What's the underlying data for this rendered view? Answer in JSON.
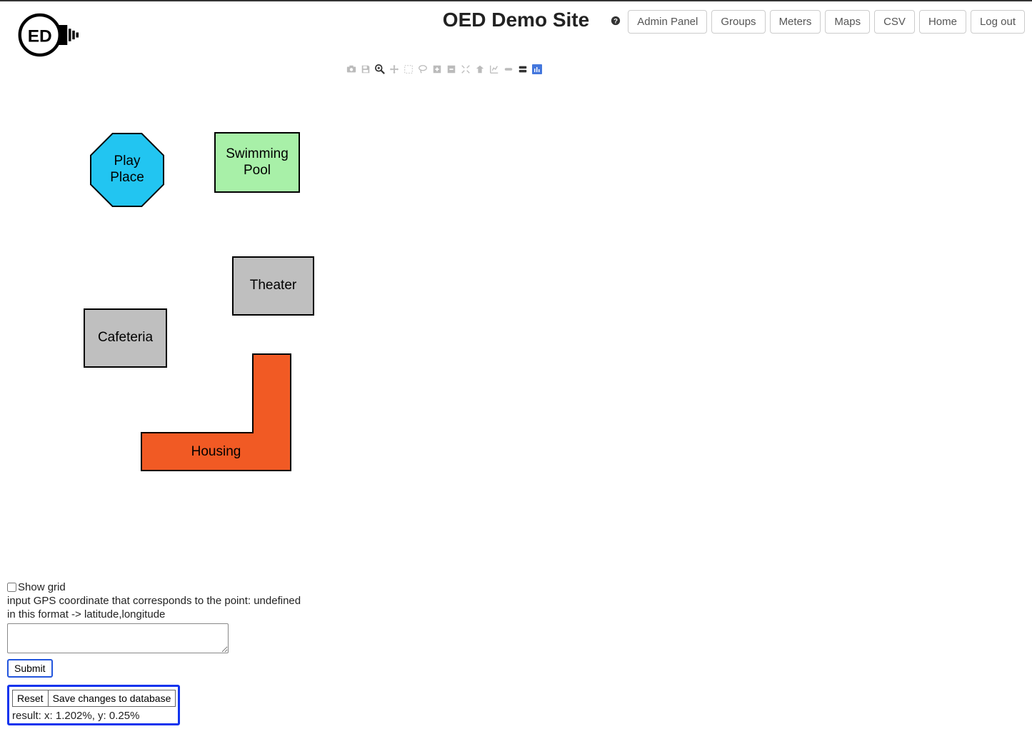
{
  "header": {
    "title": "OED Demo Site",
    "nav": [
      "Admin Panel",
      "Groups",
      "Meters",
      "Maps",
      "CSV",
      "Home",
      "Log out"
    ]
  },
  "map": {
    "shapes": {
      "play_place": "Play\nPlace",
      "pool": "Swimming\nPool",
      "theater": "Theater",
      "cafeteria": "Cafeteria",
      "housing": "Housing"
    }
  },
  "controls": {
    "show_grid_label": "Show grid",
    "gps_prompt_line1": "input GPS coordinate that corresponds to the point: undefined",
    "gps_prompt_line2": "in this format -> latitude,longitude",
    "submit_label": "Submit",
    "reset_label": "Reset",
    "save_label": "Save changes to database",
    "result_text": "result: x: 1.202%, y: 0.25%"
  }
}
